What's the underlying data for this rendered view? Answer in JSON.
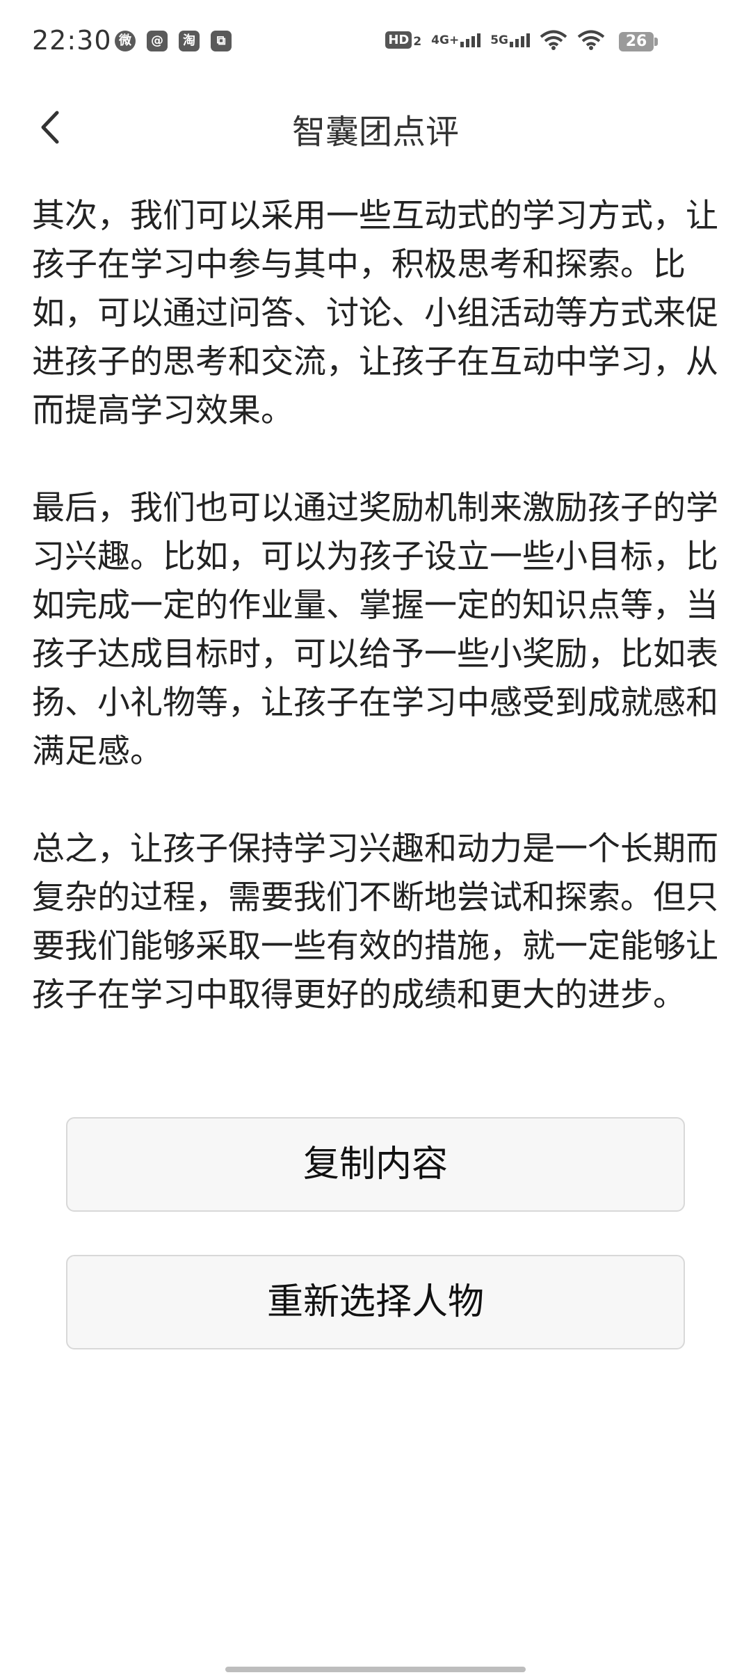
{
  "status_bar": {
    "time": "22:30",
    "notification_icons": [
      "wechat-icon",
      "message-app-icon",
      "taobao-icon",
      "app-icon"
    ],
    "notification_glyphs": [
      "微",
      "@",
      "淘",
      "⧉"
    ],
    "hd_label": "HD",
    "hd_sub": "2",
    "network_1": "4G+",
    "network_2": "5G",
    "battery": "26"
  },
  "header": {
    "title": "智囊团点评",
    "back_icon": "chevron-left-icon"
  },
  "content": {
    "paragraphs": [
      "其次，我们可以采用一些互动式的学习方式，让孩子在学习中参与其中，积极思考和探索。比如，可以通过问答、讨论、小组活动等方式来促进孩子的思考和交流，让孩子在互动中学习，从而提高学习效果。",
      "最后，我们也可以通过奖励机制来激励孩子的学习兴趣。比如，可以为孩子设立一些小目标，比如完成一定的作业量、掌握一定的知识点等，当孩子达成目标时，可以给予一些小奖励，比如表扬、小礼物等，让孩子在学习中感受到成就感和满足感。",
      "总之，让孩子保持学习兴趣和动力是一个长期而复杂的过程，需要我们不断地尝试和探索。但只要我们能够采取一些有效的措施，就一定能够让孩子在学习中取得更好的成绩和更大的进步。"
    ]
  },
  "actions": {
    "copy_label": "复制内容",
    "reselect_label": "重新选择人物"
  }
}
